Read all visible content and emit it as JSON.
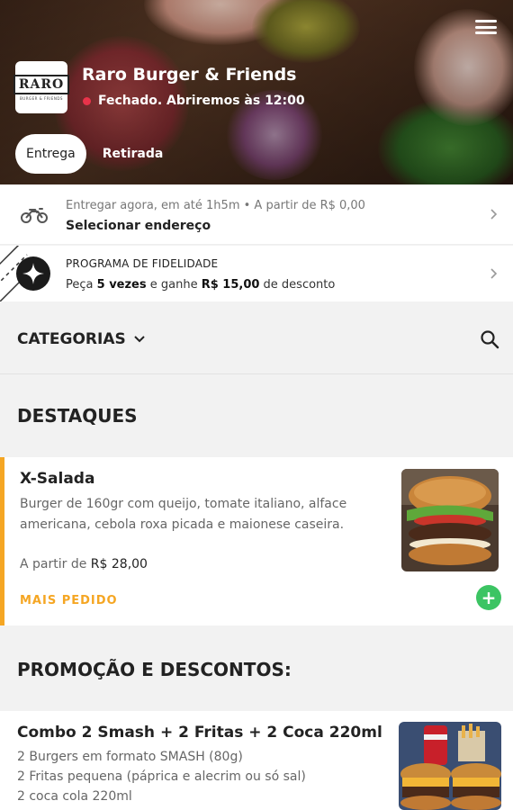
{
  "header": {
    "store_name": "Raro Burger & Friends",
    "status": "Fechado. Abriremos às 12:00",
    "status_color": "#e8334a",
    "logo_text": "RARO",
    "logo_subtext": "BURGER & FRIENDS",
    "tabs": [
      {
        "label": "Entrega",
        "active": true
      },
      {
        "label": "Retirada",
        "active": false
      }
    ]
  },
  "delivery": {
    "info": "Entregar agora, em até 1h5m  •  A partir de R$ 0,00",
    "address_label": "Selecionar endereço"
  },
  "loyalty": {
    "title": "PROGRAMA DE FIDELIDADE",
    "text_pre": "Peça ",
    "text_bold1": "5 vezes",
    "text_mid": " e ganhe ",
    "text_bold2": "R$ 15,00",
    "text_post": " de desconto"
  },
  "categories": {
    "label": "CATEGORIAS"
  },
  "sections": [
    {
      "title": "DESTAQUES",
      "products": [
        {
          "name": "X-Salada",
          "description_lines": [
            "Burger de 160gr com queijo, tomate italiano, alface",
            "americana, cebola roxa picada e maionese caseira."
          ],
          "price_prefix": "A partir de ",
          "price": "R$ 28,00",
          "tag": "MAIS PEDIDO",
          "add_label": "+"
        }
      ]
    },
    {
      "title": "PROMOÇÃO E DESCONTOS:",
      "products": [
        {
          "name": "Combo 2 Smash + 2 Fritas + 2 Coca 220ml",
          "description_lines": [
            "2 Burgers em formato SMASH (80g)",
            "2 Fritas pequena (páprica e alecrim ou só sal)",
            "2 coca cola 220ml"
          ]
        }
      ]
    }
  ],
  "colors": {
    "accent": "#f5a623",
    "add_button": "#3cc463"
  }
}
